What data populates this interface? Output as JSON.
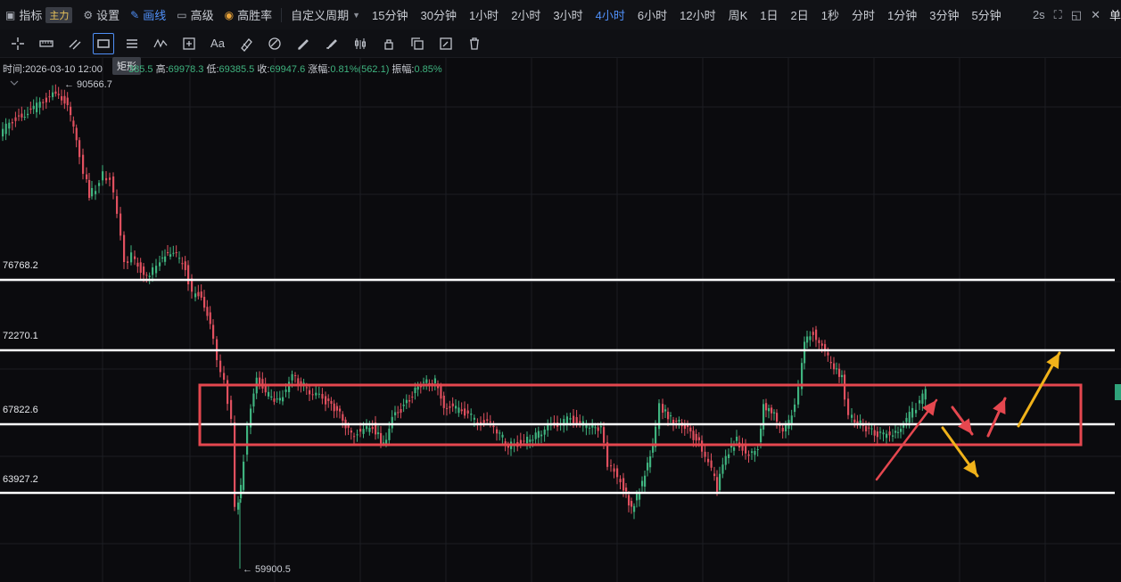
{
  "topbar": {
    "indicator_label": "指标",
    "indicator_badge": "主力",
    "settings_label": "设置",
    "draw_label": "画线",
    "advanced_label": "高级",
    "winrate_label": "高胜率",
    "custom_period_label": "自定义周期",
    "periods": [
      "15分钟",
      "30分钟",
      "1小时",
      "2小时",
      "3小时",
      "4小时",
      "6小时",
      "12小时",
      "周K",
      "1日",
      "2日",
      "1秒",
      "分时",
      "1分钟",
      "3分钟",
      "5分钟"
    ],
    "active_period": "4小时",
    "refresh_label": "2s",
    "right_text": "单"
  },
  "toolbar": {
    "tools": [
      "crosshair-icon",
      "ruler-icon",
      "parallel-lines-icon",
      "rectangle-icon",
      "horizontal-lines-icon",
      "wave-icon",
      "add-box-icon",
      "text-icon",
      "highlighter-icon",
      "eraser-icon",
      "pencil-icon",
      "brush-icon",
      "candles-icon",
      "lock-icon",
      "copy-icon",
      "edit-icon",
      "trash-icon"
    ],
    "text_tool_label": "Aa",
    "selected_tool": "rectangle-icon",
    "tooltip": "矩形"
  },
  "infobar": {
    "time_label": "时间:",
    "time_value": "2026-03-10 12:00",
    "open_value": "385.5",
    "high_label": "高:",
    "high_value": "69978.3",
    "low_label": "低:",
    "low_value": "69385.5",
    "close_label": "收:",
    "close_value": "69947.6",
    "change_label": "涨幅:",
    "change_value": "0.81%(562.1)",
    "amp_label": "振幅:",
    "amp_value": "0.85%"
  },
  "levels": [
    "76768.2",
    "72270.1",
    "67822.6",
    "63927.2"
  ],
  "extremes": {
    "high": "← 90566.7",
    "low": "← 59900.5"
  },
  "colors": {
    "up": "#3fb37f",
    "down": "#e0505f",
    "level_line": "#ffffff",
    "box": "#e5474f",
    "arrow_red": "#e5474f",
    "arrow_gold": "#f0b21a",
    "active": "#4f8ff7"
  }
}
